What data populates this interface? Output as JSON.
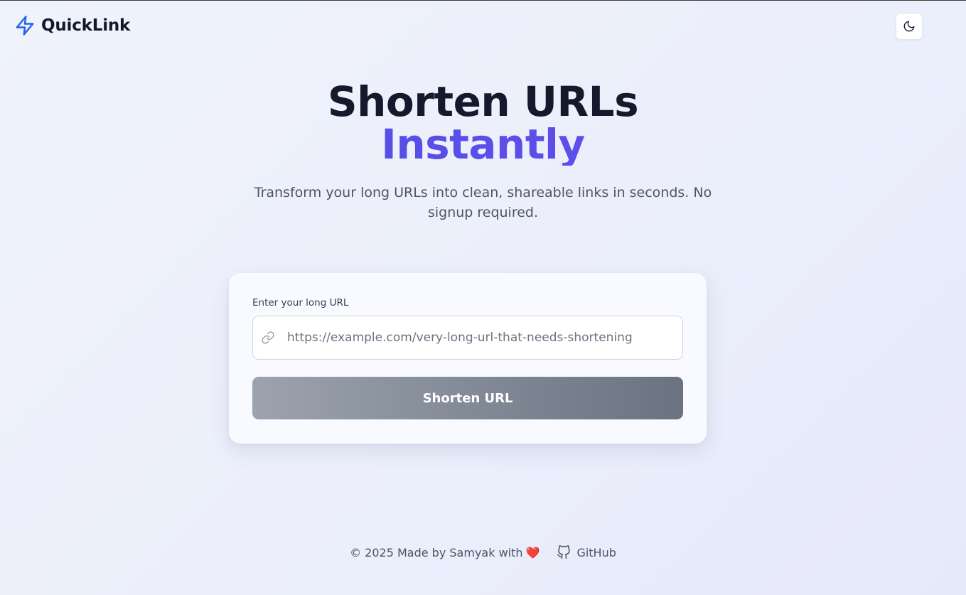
{
  "header": {
    "brand_name": "QuickLink",
    "brand_icon": "lightning-bolt-icon",
    "theme_toggle_icon": "moon-icon"
  },
  "hero": {
    "title_line1": "Shorten URLs",
    "title_line2": "Instantly",
    "subtitle": "Transform your long URLs into clean, shareable links in seconds. No signup required."
  },
  "form": {
    "label": "Enter your long URL",
    "input_icon": "link-icon",
    "input_value": "",
    "placeholder": "https://example.com/very-long-url-that-needs-shortening",
    "submit_label": "Shorten URL"
  },
  "footer": {
    "credit": "© 2025 Made by Samyak with",
    "heart": "❤️",
    "github_icon": "github-icon",
    "github_label": "GitHub"
  },
  "colors": {
    "accent": "#4f46e5",
    "brand_icon": "#2563eb",
    "button_gradient_start": "#9ca3af",
    "button_gradient_end": "#6b7280"
  }
}
